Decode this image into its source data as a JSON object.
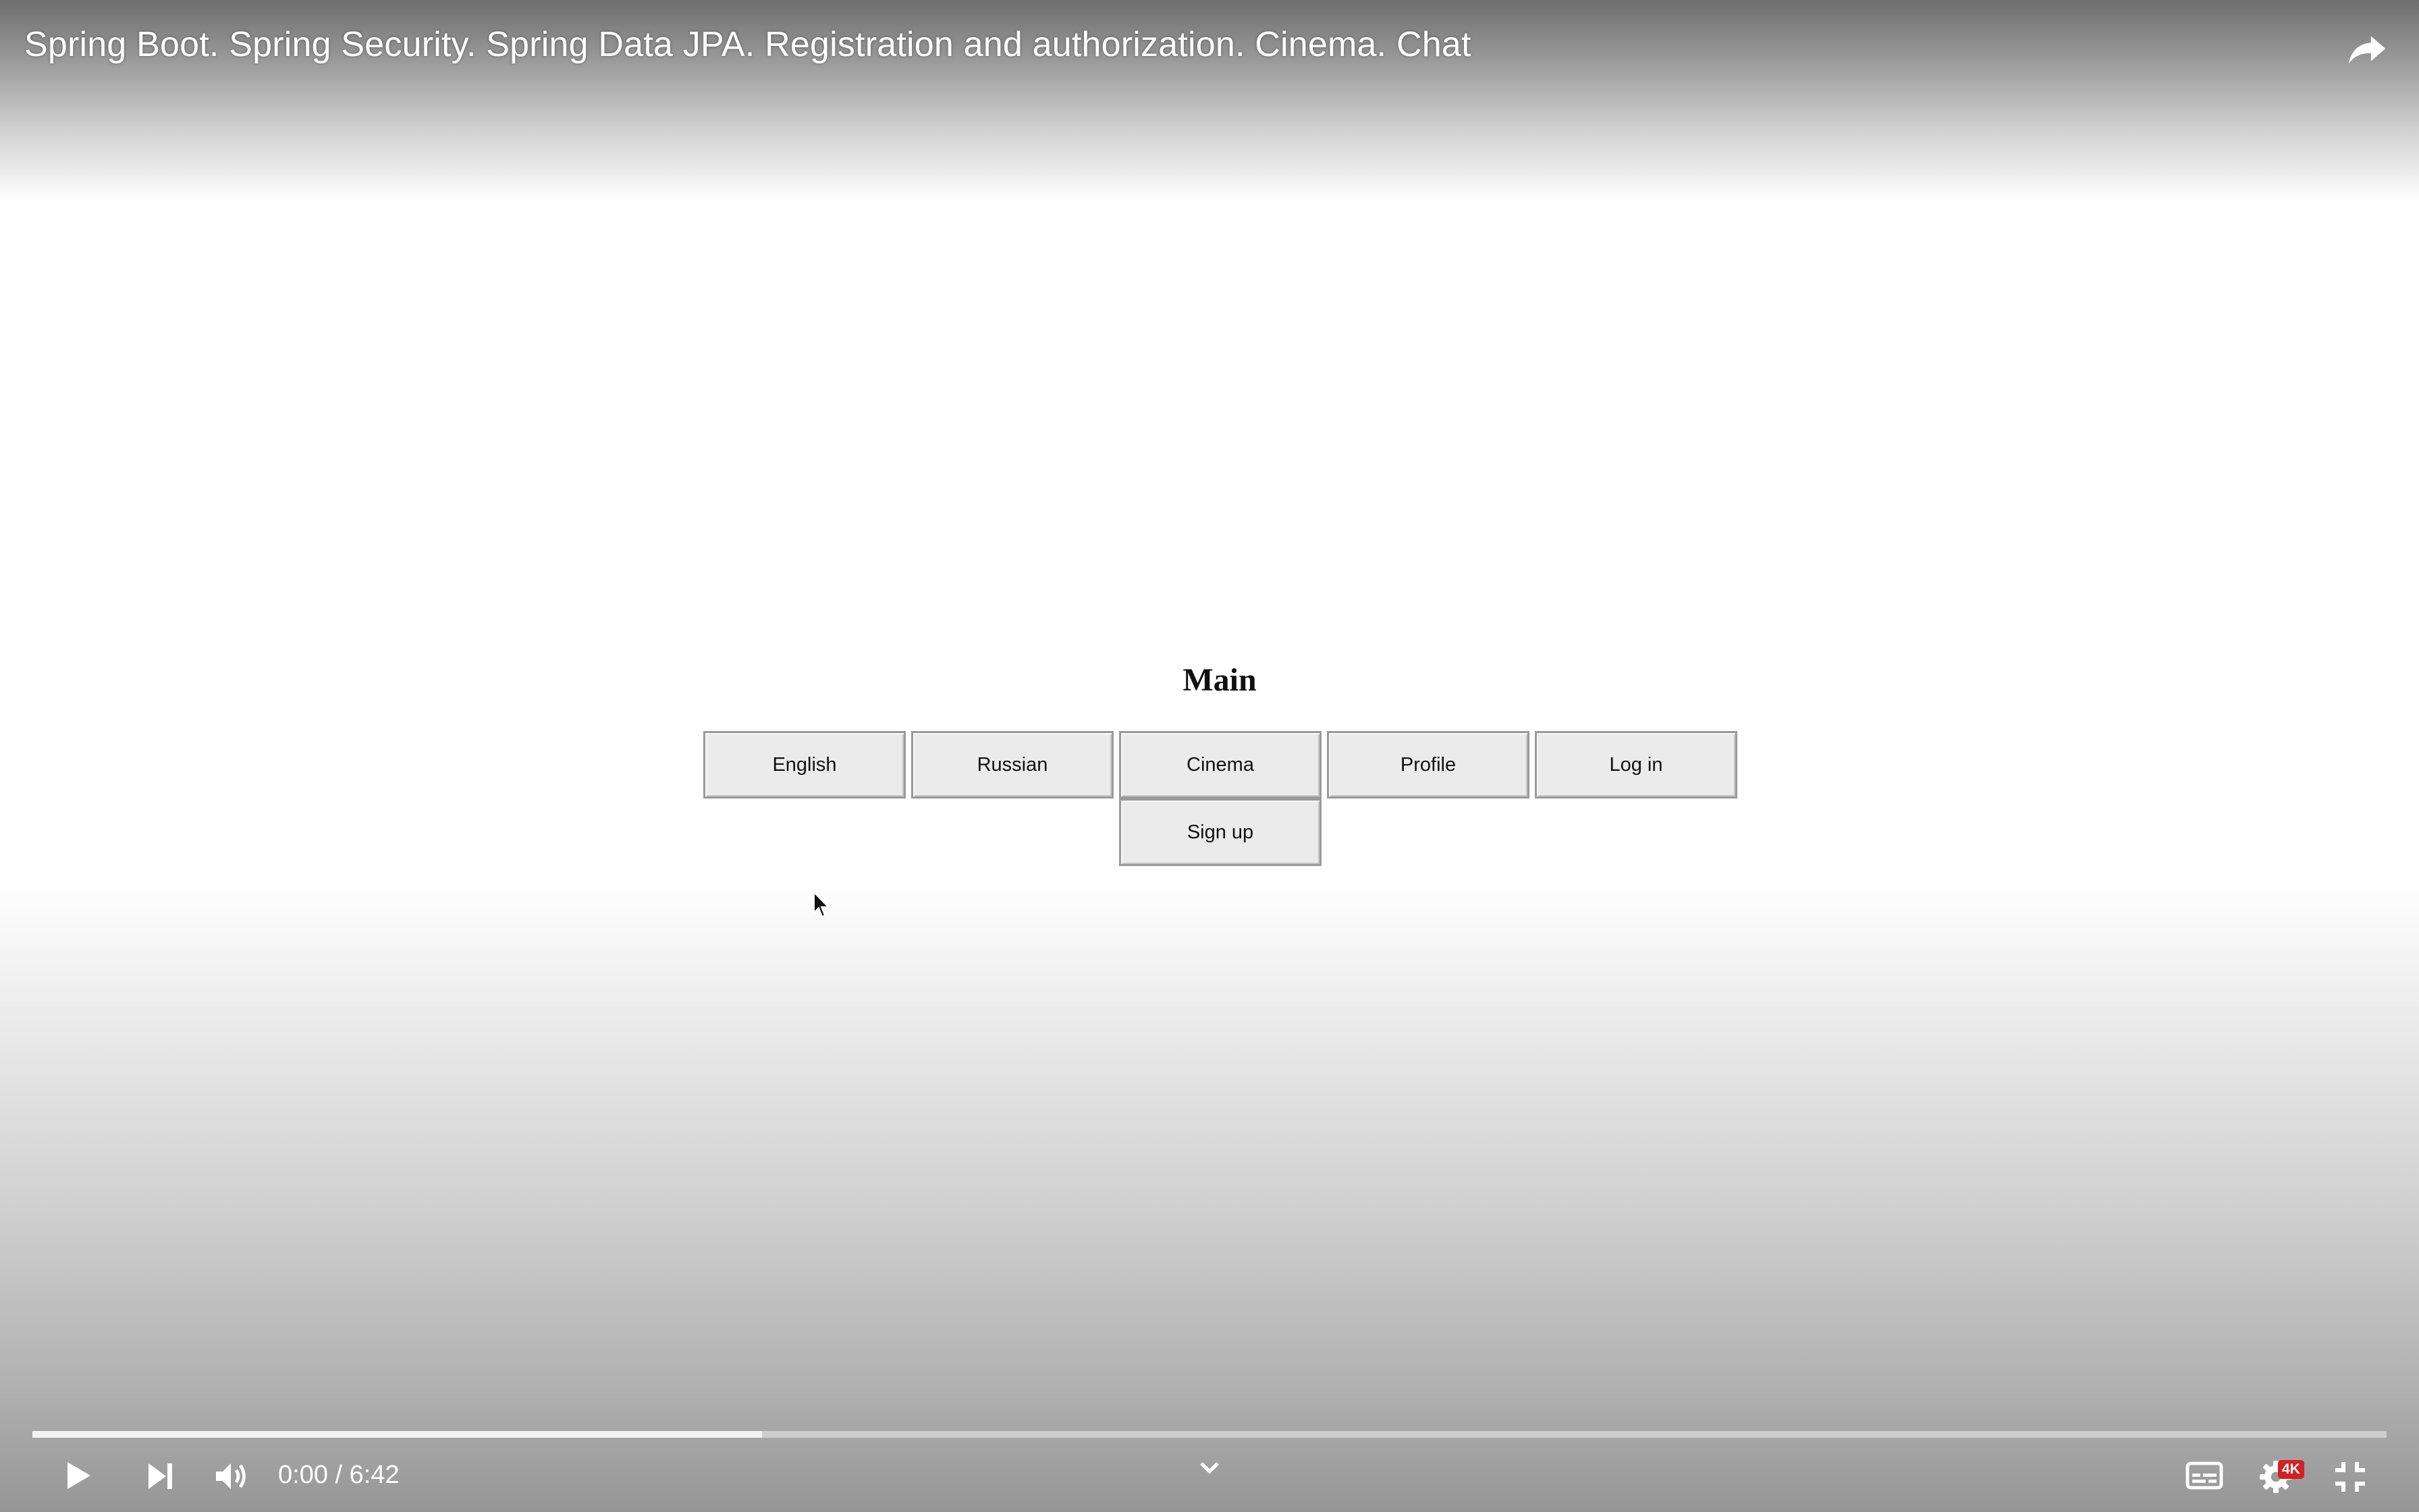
{
  "player": {
    "video_title": "Spring Boot. Spring Security. Spring Data JPA. Registration and authorization. Cinema. Chat",
    "share_icon": "share-arrow-icon"
  },
  "page": {
    "heading": "Main",
    "buttons": [
      "English",
      "Russian",
      "Cinema",
      "Profile",
      "Log in"
    ],
    "sign_up_label": "Sign up"
  },
  "controls": {
    "current_time": "0:00",
    "time_separator": "/",
    "duration": "6:42",
    "buffered_fraction": 0.31,
    "quality_badge": "4K",
    "icons": {
      "play": "play-icon",
      "next": "next-icon",
      "volume": "volume-icon",
      "chevron": "chevron-down-icon",
      "subtitles": "subtitles-icon",
      "settings": "gear-icon",
      "exit_fullscreen": "exit-fullscreen-icon"
    }
  },
  "colors": {
    "quality_badge": "#d32020",
    "button_bg": "#ebebeb",
    "button_border": "#9a9a9a"
  }
}
